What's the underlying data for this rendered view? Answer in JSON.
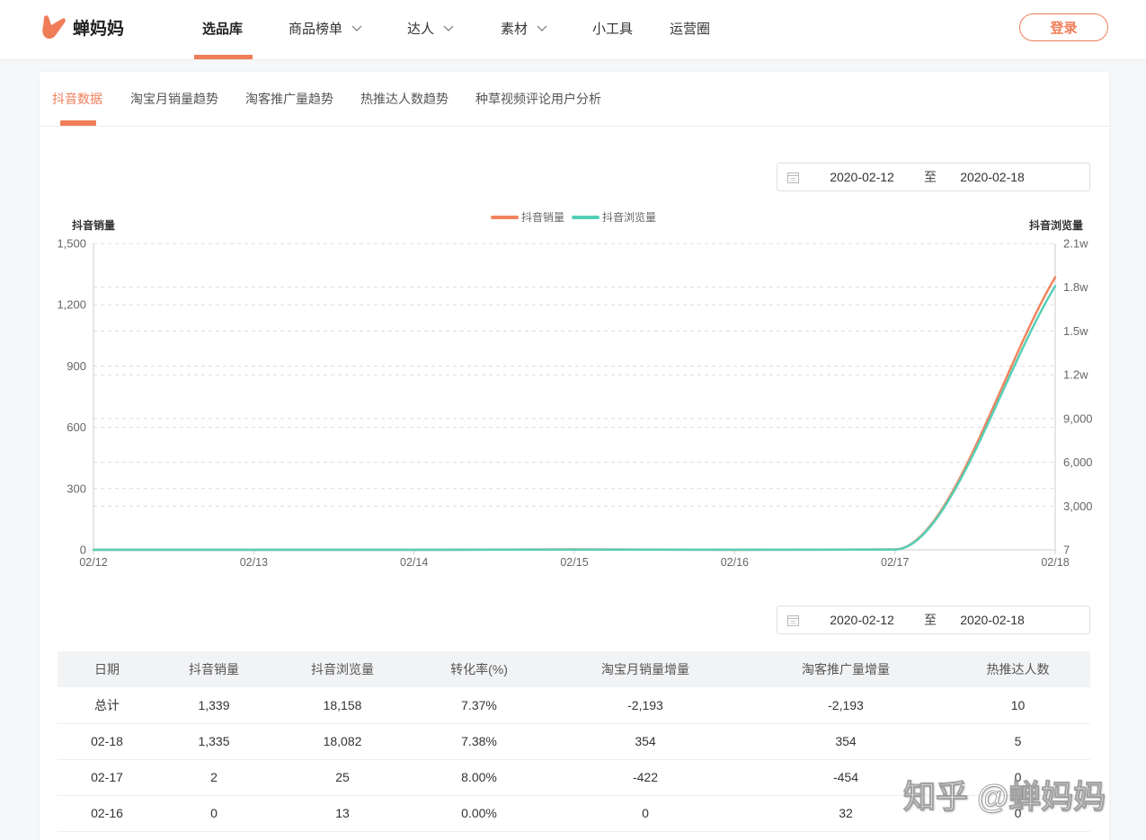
{
  "header": {
    "logo_text": "蝉妈妈",
    "nav": [
      "选品库",
      "商品榜单",
      "达人",
      "素材",
      "小工具",
      "运营圈"
    ],
    "login_label": "登录"
  },
  "tabs": [
    "抖音数据",
    "淘宝月销量趋势",
    "淘客推广量趋势",
    "热推达人数趋势",
    "种草视频评论用户分析"
  ],
  "chart_date_range": {
    "start": "2020-02-12",
    "separator": "至",
    "end": "2020-02-18"
  },
  "chart_data": {
    "type": "line",
    "x": [
      "02/12",
      "02/13",
      "02/14",
      "02/15",
      "02/16",
      "02/17",
      "02/18"
    ],
    "series": [
      {
        "name": "抖音销量",
        "axis": "left",
        "values": [
          0,
          0,
          0,
          2,
          0,
          2,
          1335
        ],
        "color": "#f2845e"
      },
      {
        "name": "抖音浏览量",
        "axis": "right",
        "values": [
          7,
          9,
          10,
          12,
          13,
          25,
          18082
        ],
        "color": "#55cfb7"
      }
    ],
    "ylabel_left": "抖音销量",
    "ylabel_right": "抖音浏览量",
    "ylim_left": [
      0,
      1500
    ],
    "yticks_left": [
      0,
      300,
      600,
      900,
      1200,
      1500
    ],
    "ytick_labels_left": [
      "0",
      "300",
      "600",
      "900",
      "1,200",
      "1,500"
    ],
    "ylim_right": [
      7,
      21000
    ],
    "yticks_right": [
      7,
      3000,
      6000,
      9000,
      12000,
      15000,
      18000,
      21000
    ],
    "ytick_labels_right": [
      "7",
      "3,000",
      "6,000",
      "9,000",
      "1.2w",
      "1.5w",
      "1.8w",
      "2.1w"
    ],
    "legend": "top-center",
    "grid": true,
    "smooth": true
  },
  "table_date_range": {
    "start": "2020-02-12",
    "separator": "至",
    "end": "2020-02-18"
  },
  "table": {
    "columns": [
      "日期",
      "抖音销量",
      "抖音浏览量",
      "转化率(%)",
      "淘宝月销量增量",
      "淘客推广量增量",
      "热推达人数"
    ],
    "rows": [
      [
        "总计",
        "1,339",
        "18,158",
        "7.37%",
        "-2,193",
        "-2,193",
        "10"
      ],
      [
        "02-18",
        "1,335",
        "18,082",
        "7.38%",
        "354",
        "354",
        "5"
      ],
      [
        "02-17",
        "2",
        "25",
        "8.00%",
        "-422",
        "-454",
        "0"
      ],
      [
        "02-16",
        "0",
        "13",
        "0.00%",
        "0",
        "32",
        "0"
      ]
    ]
  },
  "watermark": "知乎 @蝉妈妈",
  "colors": {
    "accent": "#ef7d57",
    "table_header_bg": "#f2f3f5"
  },
  "icons": {
    "logo": "chanmama-logo-icon",
    "dropdown": "chevron-down-icon",
    "date": "calendar-icon"
  }
}
